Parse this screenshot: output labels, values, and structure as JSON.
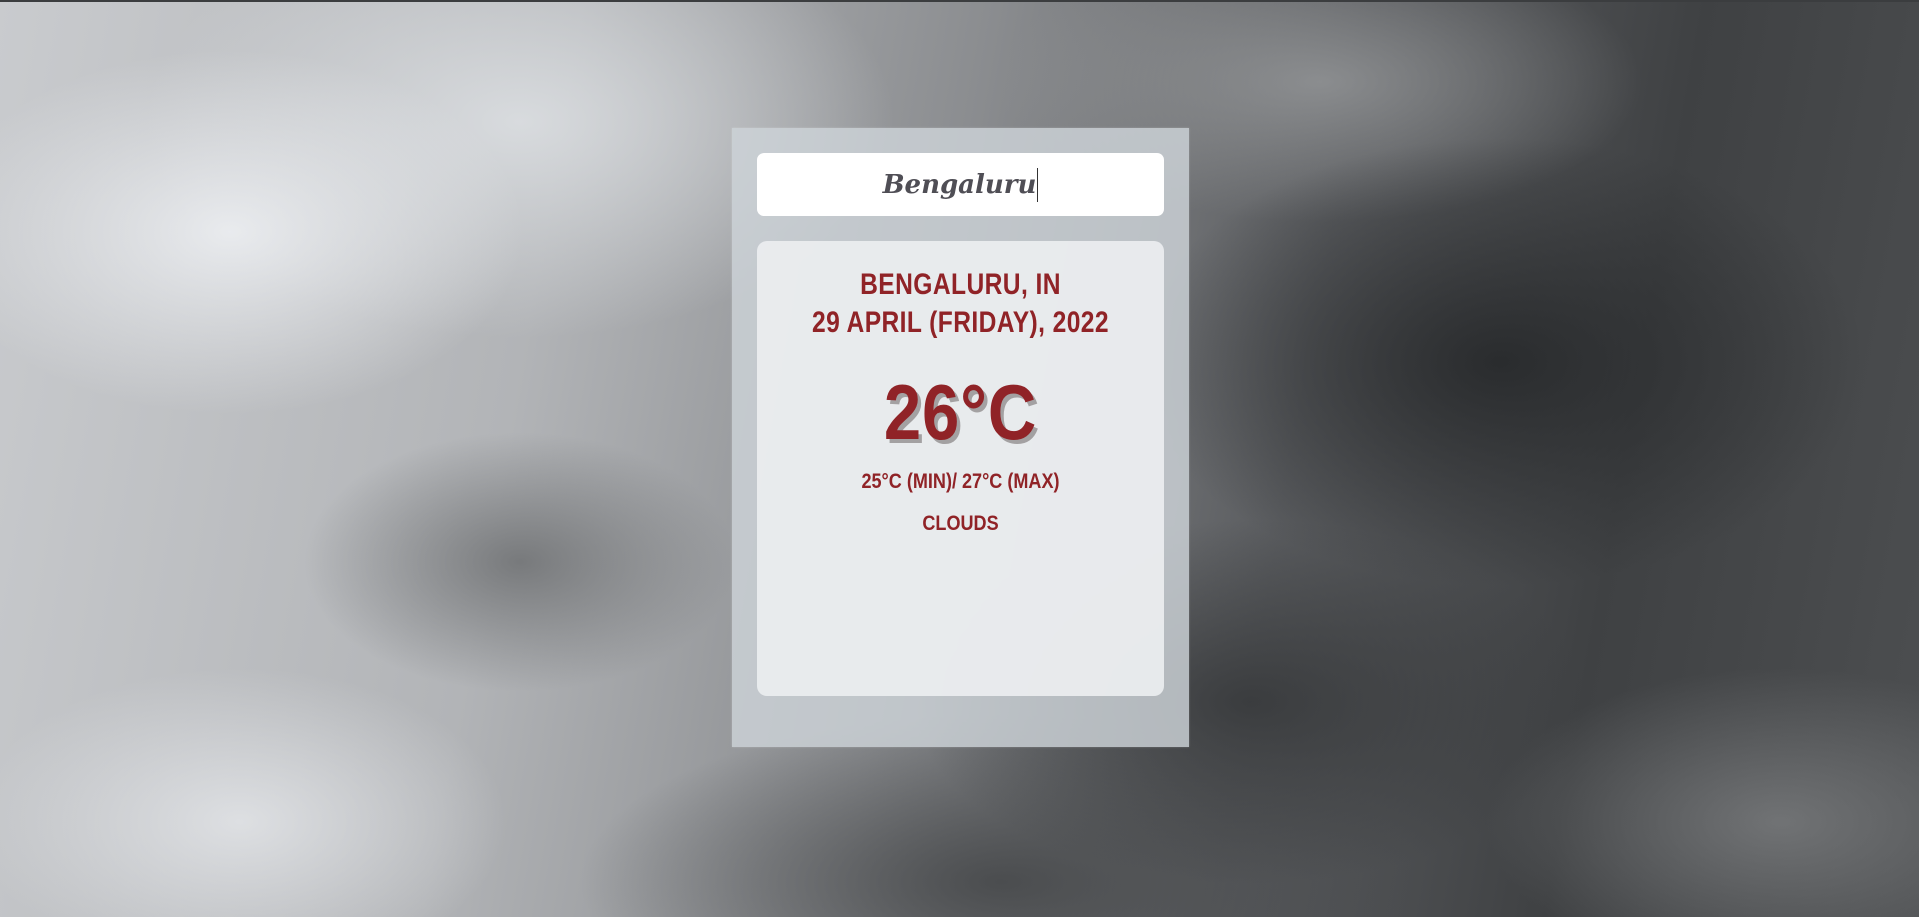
{
  "search": {
    "value": "Bengaluru"
  },
  "weather_card": {
    "location": "BENGALURU, IN",
    "date": "29 APRIL (FRIDAY), 2022",
    "temperature": "26°C",
    "min_max": "25°C (MIN)/ 27°C (MAX)",
    "condition": "CLOUDS"
  },
  "colors": {
    "accent_text": "#902327",
    "panel": "#cdd3d8",
    "card": "#eceef0",
    "search_bg": "#ffffff"
  }
}
